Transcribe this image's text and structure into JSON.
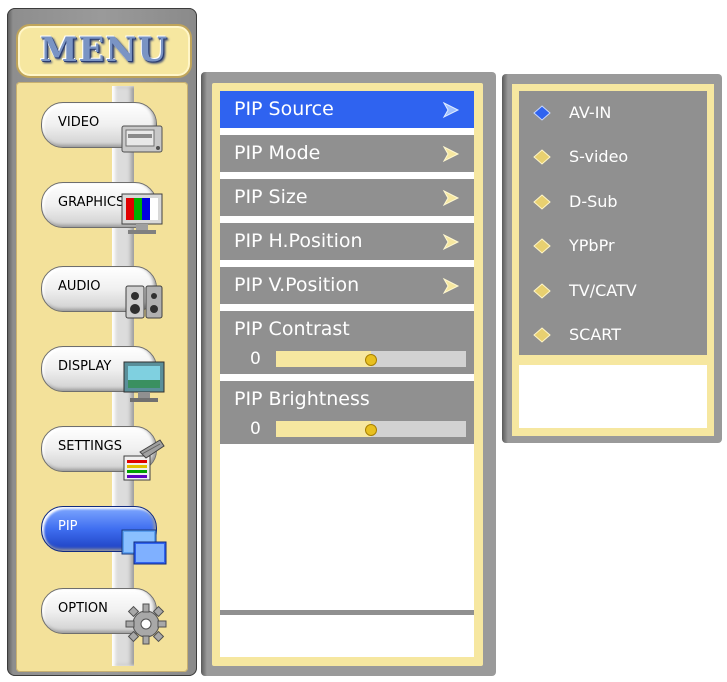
{
  "menu": {
    "title": "MENU",
    "items": [
      {
        "label": "VIDEO",
        "icon": "video-player-icon"
      },
      {
        "label": "GRAPHICS",
        "icon": "monitor-color-bars-icon"
      },
      {
        "label": "AUDIO",
        "icon": "speaker-icon"
      },
      {
        "label": "DISPLAY",
        "icon": "display-monitor-icon"
      },
      {
        "label": "SETTINGS",
        "icon": "settings-tools-icon"
      },
      {
        "label": "PIP",
        "icon": "pip-windows-icon",
        "active": true
      },
      {
        "label": "OPTION",
        "icon": "gear-icon"
      }
    ]
  },
  "pip": {
    "items": [
      {
        "label": "PIP Source",
        "selected": true
      },
      {
        "label": "PIP Mode"
      },
      {
        "label": "PIP Size"
      },
      {
        "label": "PIP H.Position"
      },
      {
        "label": "PIP V.Position"
      }
    ],
    "contrast": {
      "label": "PIP Contrast",
      "value": "0",
      "level": 0.5
    },
    "brightness": {
      "label": "PIP Brightness",
      "value": "0",
      "level": 0.5
    }
  },
  "source": {
    "options": [
      {
        "label": "AV-IN",
        "selected": true
      },
      {
        "label": "S-video"
      },
      {
        "label": "D-Sub"
      },
      {
        "label": "YPbPr"
      },
      {
        "label": "TV/CATV"
      },
      {
        "label": "SCART"
      }
    ]
  },
  "colors": {
    "selected_blue": "#2f63f0",
    "row_gray": "#909090",
    "panel_yellow": "#f6e7a0",
    "frame_gray": "#9a9a9a"
  }
}
